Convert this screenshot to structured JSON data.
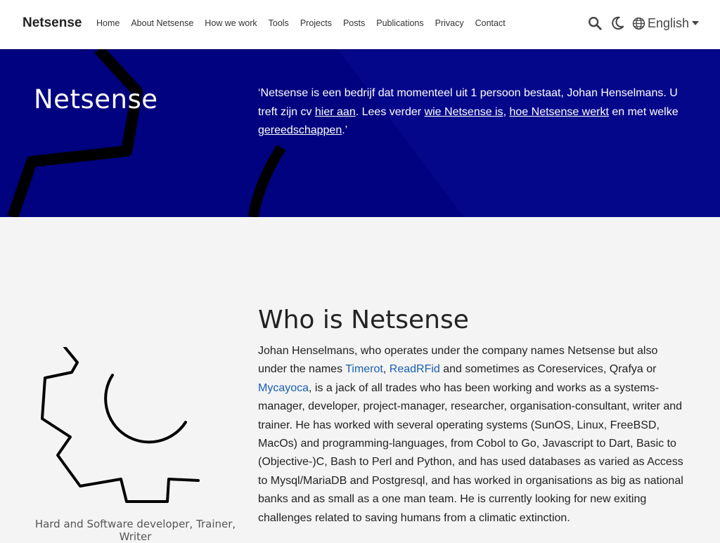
{
  "nav": {
    "brand": "Netsense",
    "links": [
      "Home",
      "About Netsense",
      "How we work",
      "Tools",
      "Projects",
      "Posts",
      "Publications",
      "Privacy",
      "Contact"
    ],
    "language": "English",
    "icons": [
      "search-icon",
      "moon-icon",
      "globe-icon"
    ]
  },
  "hero": {
    "title": "Netsense",
    "quote_parts": {
      "p1": "‘Netsense is een bedrijf dat momenteel uit 1 persoon bestaat, Johan Henselmans. U treft zijn cv ",
      "link1": "hier aan",
      "p2": ". Lees verder ",
      "link2": "wie Netsense is",
      "p3": ", ",
      "link3": "hoe Netsense werkt",
      "p4": " en met welke ",
      "link4": "gereedschappen",
      "p5": ".’"
    },
    "background_color": "#00027f"
  },
  "about": {
    "title": "Who is Netsense",
    "text_parts": {
      "p1": "Johan Henselmans, who operates under the company names Netsense but also under the names ",
      "link1": "Timerot",
      "p2": ", ",
      "link2": "ReadRFid",
      "p3": " and sometimes as Coreservices, Qrafya or ",
      "link3": "Mycayoca",
      "p4": ", is a jack of all trades who has been working and works as a systems-manager, developer, project-manager, researcher, organisation-consultant, writer and trainer. He has worked with several operating systems (SunOS, Linux, FreeBSD, MacOs) and programming-languages, from Cobol to Go, Javascript to Dart, Basic to (Objective-)C, Bash to Perl and Python, and has used databases as varied as Access to Mysql/MariaDB and Postgresql, and has worked in organisations as big as national banks and as small as a one man team. He is currently looking for new exiting challenges related to saving humans from a climatic extinction."
    },
    "caption": "Hard and Software developer, Trainer, Writer",
    "link_color": "#1a5fb4"
  }
}
